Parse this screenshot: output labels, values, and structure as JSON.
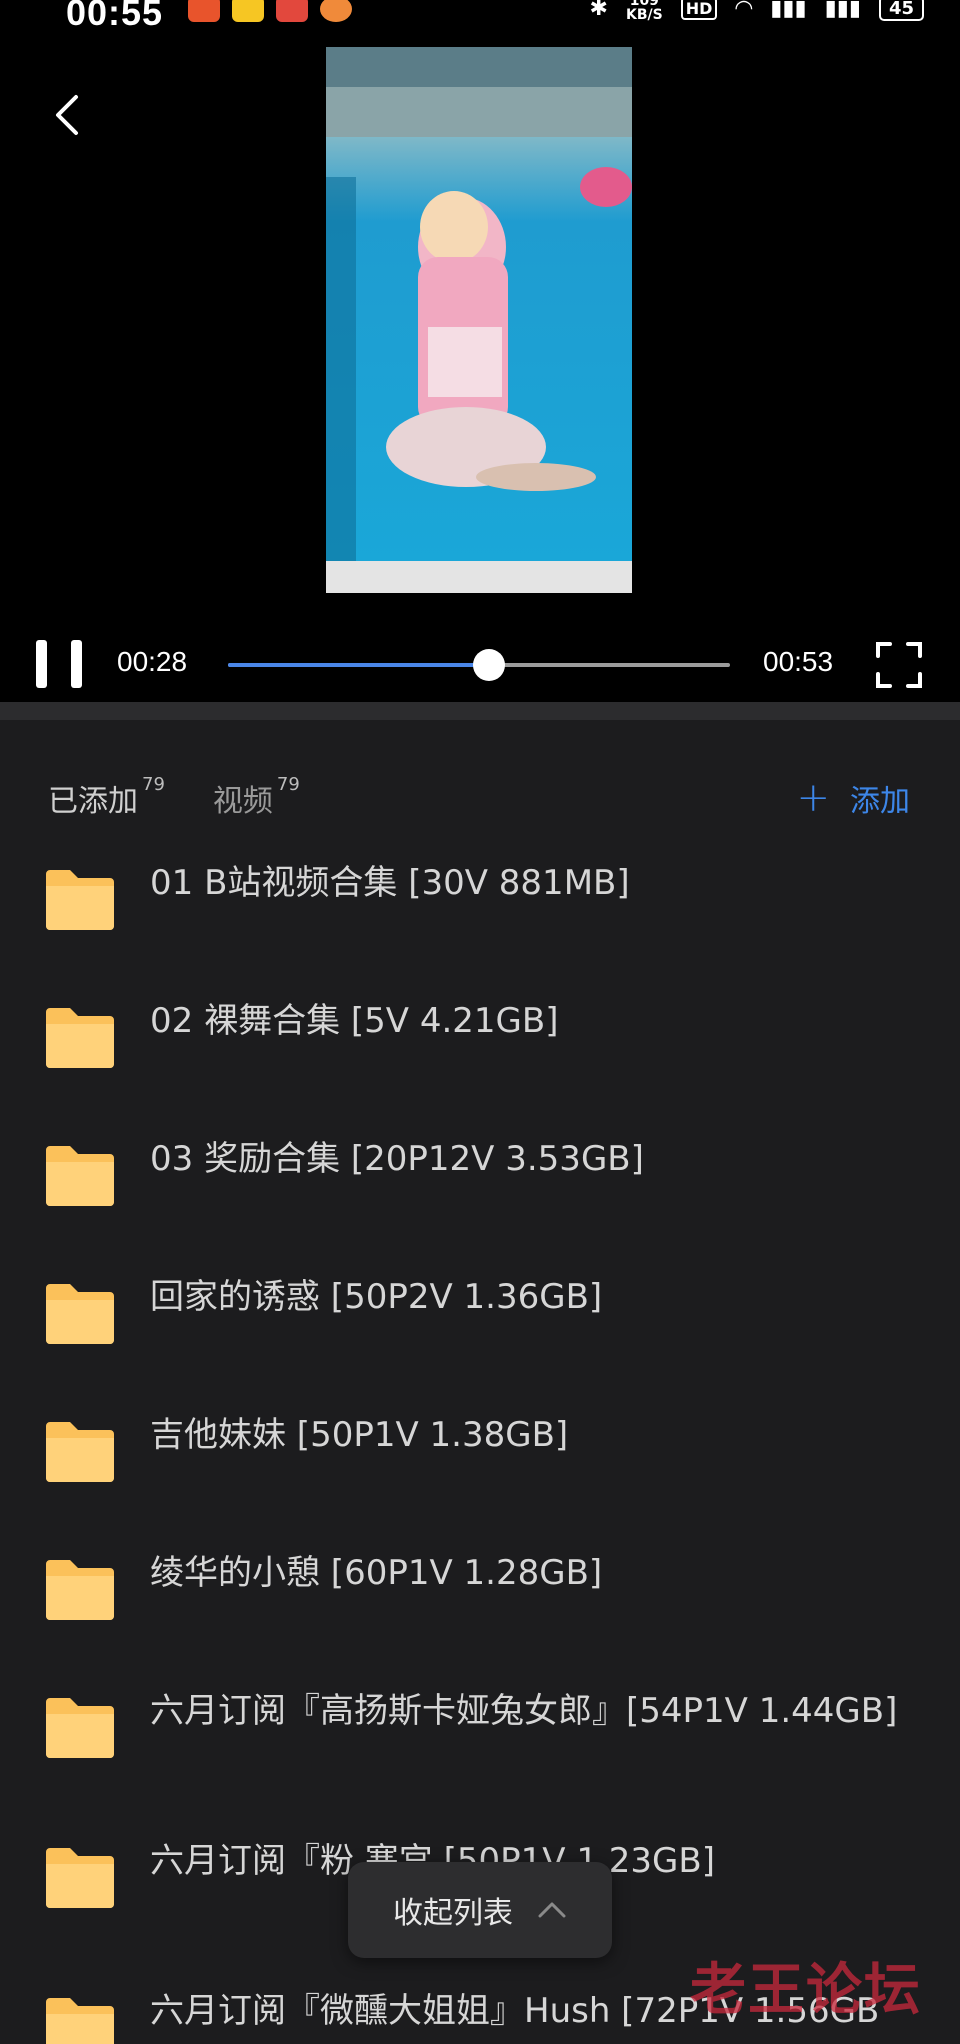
{
  "status_bar": {
    "time": "00:55",
    "net_speed_value": "109",
    "net_speed_unit": "KB/S",
    "hd_label": "HD",
    "battery": "45",
    "notification_icons": [
      "huawei-music-icon",
      "meituan-icon",
      "app-icon-red",
      "app-icon-orange"
    ]
  },
  "player": {
    "current_time": "00:28",
    "total_time": "00:53",
    "progress": 0.52,
    "state": "playing"
  },
  "tabs": [
    {
      "label": "已添加",
      "count": "79",
      "active": true
    },
    {
      "label": "视频",
      "count": "79",
      "active": false
    }
  ],
  "add_button": {
    "label": "添加"
  },
  "items": [
    {
      "label": "01 B站视频合集 [30V 881MB]"
    },
    {
      "label": "02 裸舞合集 [5V 4.21GB]"
    },
    {
      "label": "03 奖励合集 [20P12V 3.53GB]"
    },
    {
      "label": "回家的诱惑 [50P2V 1.36GB]"
    },
    {
      "label": "吉他妹妹 [50P1V 1.38GB]"
    },
    {
      "label": "绫华的小憩 [60P1V 1.28GB]"
    },
    {
      "label": "六月订阅『高扬斯卡娅兔女郎』[54P1V 1.44GB]"
    },
    {
      "label": "六月订阅『粉 寒宫 [50P1V 1.23GB]"
    },
    {
      "label": "六月订阅『微醺大姐姐』Hush [72P1V 1.56GB"
    }
  ],
  "collapse_button": {
    "label": "收起列表"
  },
  "watermark": "老王论坛",
  "colors": {
    "accent": "#4a86e8",
    "folder": "#fbc15a",
    "background": "#1c1c1e"
  }
}
